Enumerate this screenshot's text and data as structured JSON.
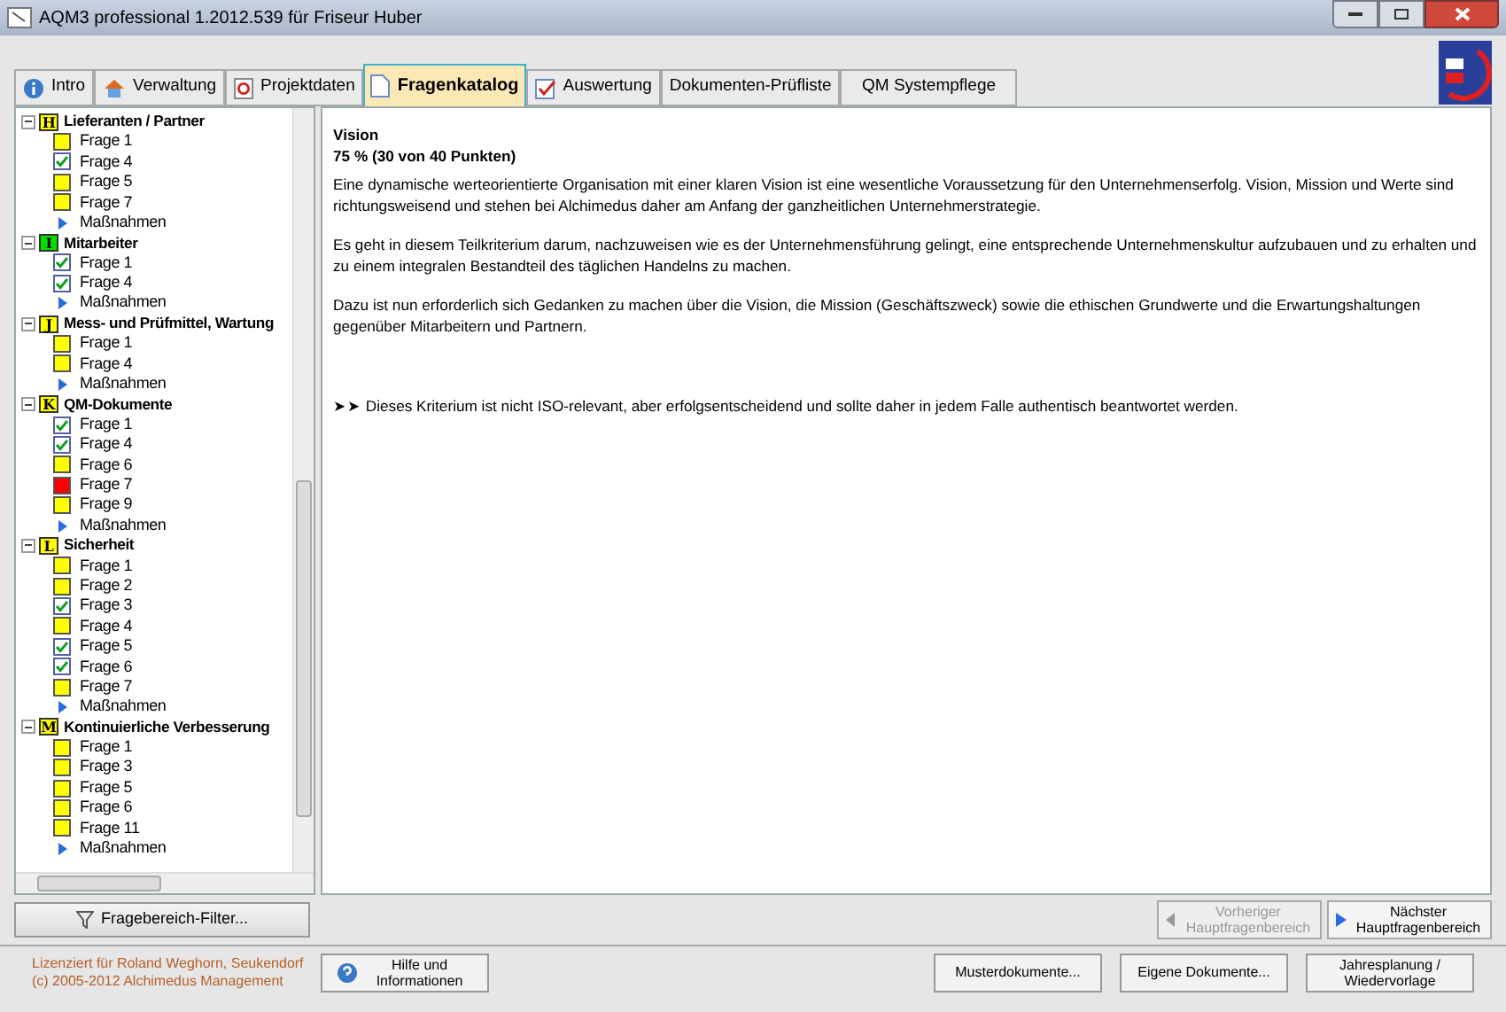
{
  "window": {
    "title": "AQM3 professional 1.2012.539 für Friseur Huber"
  },
  "tabs": [
    {
      "label": "Intro",
      "selected": false,
      "kind": "info"
    },
    {
      "label": "Verwaltung",
      "selected": false,
      "kind": "house"
    },
    {
      "label": "Projektdaten",
      "selected": false,
      "kind": "letter"
    },
    {
      "label": "Fragenkatalog",
      "selected": true,
      "kind": "page"
    },
    {
      "label": "Auswertung",
      "selected": false,
      "kind": "chart"
    },
    {
      "label": "Dokumenten-Prüfliste",
      "selected": false,
      "kind": "plain"
    },
    {
      "label": "QM Systempflege",
      "selected": false,
      "kind": "plain"
    }
  ],
  "tree": [
    {
      "letter": "H",
      "label": "Lieferanten / Partner",
      "color": "#ffff00",
      "expanded": true,
      "children": [
        {
          "label": "Frage 1",
          "kind": "open"
        },
        {
          "label": "Frage 4",
          "kind": "done"
        },
        {
          "label": "Frage 5",
          "kind": "open"
        },
        {
          "label": "Frage 7",
          "kind": "open"
        },
        {
          "label": "Maßnahmen",
          "kind": "action"
        }
      ]
    },
    {
      "letter": "I",
      "label": "Mitarbeiter",
      "color": "#00e000",
      "expanded": true,
      "children": [
        {
          "label": "Frage 1",
          "kind": "done"
        },
        {
          "label": "Frage 4",
          "kind": "done"
        },
        {
          "label": "Maßnahmen",
          "kind": "action"
        }
      ]
    },
    {
      "letter": "J",
      "label": "Mess- und Prüfmittel, Wartung",
      "color": "#ffff00",
      "expanded": true,
      "children": [
        {
          "label": "Frage 1",
          "kind": "open"
        },
        {
          "label": "Frage 4",
          "kind": "open"
        },
        {
          "label": "Maßnahmen",
          "kind": "action"
        }
      ]
    },
    {
      "letter": "K",
      "label": "QM-Dokumente",
      "color": "#ffff00",
      "expanded": true,
      "children": [
        {
          "label": "Frage 1",
          "kind": "done"
        },
        {
          "label": "Frage 4",
          "kind": "done"
        },
        {
          "label": "Frage 6",
          "kind": "open"
        },
        {
          "label": "Frage 7",
          "kind": "failed"
        },
        {
          "label": "Frage 9",
          "kind": "open"
        },
        {
          "label": "Maßnahmen",
          "kind": "action"
        }
      ]
    },
    {
      "letter": "L",
      "label": "Sicherheit",
      "color": "#ffff00",
      "expanded": true,
      "children": [
        {
          "label": "Frage 1",
          "kind": "open"
        },
        {
          "label": "Frage 2",
          "kind": "open"
        },
        {
          "label": "Frage 3",
          "kind": "done"
        },
        {
          "label": "Frage 4",
          "kind": "open"
        },
        {
          "label": "Frage 5",
          "kind": "done"
        },
        {
          "label": "Frage 6",
          "kind": "done"
        },
        {
          "label": "Frage 7",
          "kind": "open"
        },
        {
          "label": "Maßnahmen",
          "kind": "action"
        }
      ]
    },
    {
      "letter": "M",
      "label": "Kontinuierliche Verbesserung",
      "color": "#ffff00",
      "expanded": true,
      "children": [
        {
          "label": "Frage 1",
          "kind": "open"
        },
        {
          "label": "Frage 3",
          "kind": "open"
        },
        {
          "label": "Frage 5",
          "kind": "open"
        },
        {
          "label": "Frage 6",
          "kind": "open"
        },
        {
          "label": "Frage 11",
          "kind": "open"
        },
        {
          "label": "Maßnahmen",
          "kind": "action"
        }
      ]
    }
  ],
  "filter_button": "Fragebereich-Filter...",
  "content": {
    "title": "Vision",
    "score": "75 % (30 von 40 Punkten)",
    "paragraphs": [
      "Eine dynamische werteorientierte Organisation mit einer klaren Vision ist eine wesentliche Voraussetzung für den Unternehmenserfolg. Vision, Mission und Werte sind richtungsweisend und stehen bei Alchimedus daher am Anfang der ganzheitlichen Unternehmerstrategie.",
      "Es geht in diesem Teilkriterium darum, nachzuweisen wie es der Unternehmensführung gelingt, eine entsprechende Unternehmenskultur aufzubauen und zu erhalten und zu einem integralen Bestandteil des täglichen Handelns zu machen.",
      "Dazu ist nun erforderlich sich Gedanken zu machen über die Vision, die Mission (Geschäftszweck) sowie die ethischen Grundwerte und die Erwartungshaltungen gegenüber Mitarbeitern und Partnern."
    ],
    "note": "➤➤ Dieses Kriterium ist nicht ISO-relevant, aber erfolgsentscheidend und sollte daher in jedem Falle authentisch beantwortet werden."
  },
  "nav": [
    {
      "label": "Vorheriger Hauptfragenbereich",
      "disabled": true,
      "kind": "prev"
    },
    {
      "label": "Nächster Hauptfragenbereich",
      "disabled": false,
      "kind": "next"
    }
  ],
  "license": [
    "Lizenziert für Roland Weghorn, Seukendorf",
    "(c) 2005-2012 Alchimedus Management"
  ],
  "help_button": "Hilfe und Informationen",
  "footer_buttons": [
    "Musterdokumente...",
    "Eigene Dokumente...",
    "Jahresplanung / Wiedervorlage"
  ]
}
